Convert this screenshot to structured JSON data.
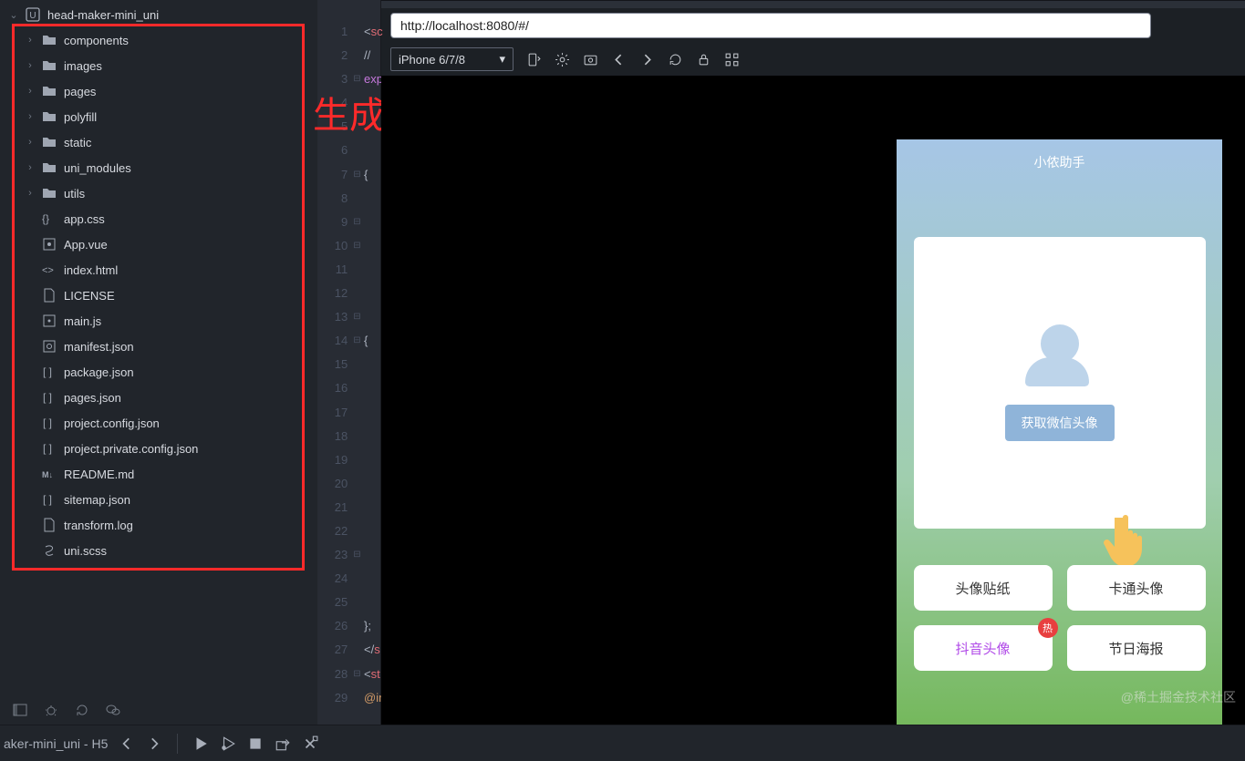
{
  "project": {
    "name": "head-maker-mini_uni"
  },
  "tree": {
    "folders": [
      {
        "name": "components"
      },
      {
        "name": "images"
      },
      {
        "name": "pages"
      },
      {
        "name": "polyfill"
      },
      {
        "name": "static"
      },
      {
        "name": "uni_modules"
      },
      {
        "name": "utils"
      }
    ],
    "files": [
      {
        "name": "app.css",
        "icon": "css"
      },
      {
        "name": "App.vue",
        "icon": "vue"
      },
      {
        "name": "index.html",
        "icon": "html"
      },
      {
        "name": "LICENSE",
        "icon": "file"
      },
      {
        "name": "main.js",
        "icon": "js"
      },
      {
        "name": "manifest.json",
        "icon": "gear"
      },
      {
        "name": "package.json",
        "icon": "json"
      },
      {
        "name": "pages.json",
        "icon": "json"
      },
      {
        "name": "project.config.json",
        "icon": "json"
      },
      {
        "name": "project.private.config.json",
        "icon": "json"
      },
      {
        "name": "README.md",
        "icon": "md"
      },
      {
        "name": "sitemap.json",
        "icon": "json"
      },
      {
        "name": "transform.log",
        "icon": "file"
      },
      {
        "name": "uni.scss",
        "icon": "scss"
      }
    ]
  },
  "annotation": "生成后",
  "editor": {
    "lines": [
      "<sc",
      "//",
      "exp",
      "",
      "",
      "",
      "{",
      "",
      "",
      "",
      "",
      "",
      "",
      "{",
      "",
      "",
      "",
      "",
      "",
      "",
      "",
      "",
      "",
      "",
      "",
      "};",
      "</s",
      "<st",
      "@im"
    ],
    "line_numbers": [
      "1",
      "2",
      "3",
      "4",
      "5",
      "6",
      "7",
      "8",
      "9",
      "10",
      "11",
      "12",
      "13",
      "14",
      "15",
      "16",
      "17",
      "18",
      "19",
      "20",
      "21",
      "22",
      "23",
      "24",
      "25",
      "26",
      "27",
      "28",
      "29"
    ]
  },
  "preview": {
    "url": "http://localhost:8080/#/",
    "device": "iPhone 6/7/8"
  },
  "phone": {
    "title": "小侬助手",
    "get_avatar_btn": "获取微信头像",
    "buttons": [
      {
        "label": "头像贴纸"
      },
      {
        "label": "卡通头像"
      },
      {
        "label": "抖音头像",
        "purple": true,
        "hot": true
      },
      {
        "label": "节日海报"
      }
    ]
  },
  "watermark": "@稀土掘金技术社区",
  "footer": {
    "run_label": "aker-mini_uni - H5"
  }
}
